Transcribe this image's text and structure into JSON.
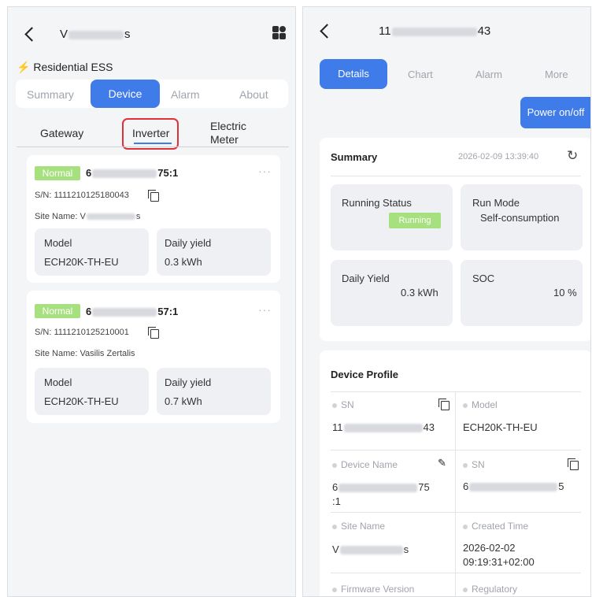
{
  "left": {
    "header": {
      "title_start": "V",
      "title_end": "s"
    },
    "system_label": "Residential ESS",
    "tabs": [
      "Summary",
      "Device",
      "Alarm",
      "About"
    ],
    "subtabs": [
      "Gateway",
      "Inverter",
      "Electric",
      "Meter"
    ],
    "devices": [
      {
        "status": "Normal",
        "id_start": "6",
        "id_end": "75:1",
        "sn": "S/N: 1111210125180043",
        "site_prefix": "Site Name: V",
        "site_suffix": "s",
        "model_label": "Model",
        "model": "ECH20K-TH-EU",
        "yield_label": "Daily yield",
        "yield": "0.3 kWh"
      },
      {
        "status": "Normal",
        "id_start": "6",
        "id_end": "57:1",
        "sn": "S/N: 1111210125210001",
        "site": "Site Name: Vasilis Zertalis",
        "model_label": "Model",
        "model": "ECH20K-TH-EU",
        "yield_label": "Daily yield",
        "yield": "0.7 kWh"
      }
    ]
  },
  "right": {
    "header": {
      "title_start": "11",
      "title_end": "43"
    },
    "tabs": [
      "Details",
      "Chart",
      "Alarm",
      "More"
    ],
    "power_button": "Power on/off",
    "summary": {
      "title": "Summary",
      "timestamp": "2026-02-09 13:39:40",
      "running_status_label": "Running Status",
      "running_status": "Running",
      "run_mode_label": "Run Mode",
      "run_mode": "Self-consumption",
      "daily_yield_label": "Daily Yield",
      "daily_yield": "0.3 kWh",
      "soc_label": "SOC",
      "soc": "10 %"
    },
    "profile": {
      "title": "Device Profile",
      "sn_label": "SN",
      "sn_start": "11",
      "sn_end": "43",
      "model_label": "Model",
      "model": "ECH20K-TH-EU",
      "device_name_label": "Device Name",
      "device_name_start": "6",
      "device_name_end": "75",
      "device_name_line2": ":1",
      "sn2_label": "SN",
      "sn2_start": "6",
      "sn2_end": "5",
      "site_name_label": "Site Name",
      "site_start": "V",
      "site_end": "s",
      "created_label": "Created Time",
      "created_date": "2026-02-02",
      "created_time": "09:19:31+02:00",
      "firmware_label": "Firmware Version",
      "regulatory_label": "Regulatory"
    }
  },
  "colors": {
    "accent": "#3f7be9",
    "highlight": "#e0313a",
    "status_green": "#a6e07f",
    "bolt": "#f5a623"
  }
}
